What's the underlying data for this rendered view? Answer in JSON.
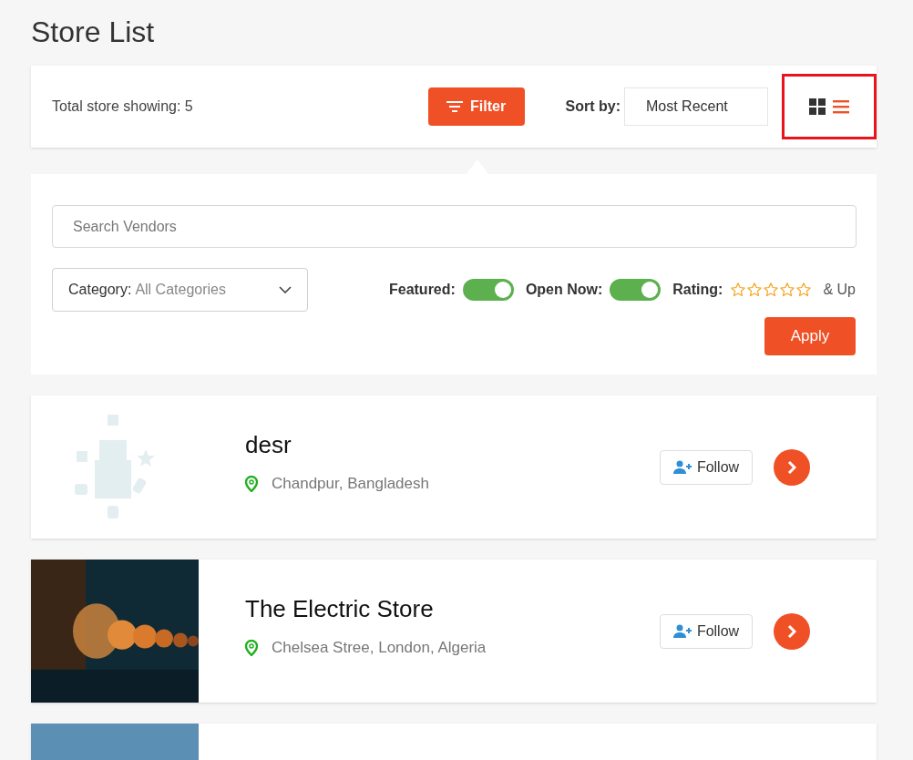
{
  "page_title": "Store List",
  "toolbar": {
    "count_text": "Total store showing: 5",
    "filter_button": "Filter",
    "sort_label": "Sort by:",
    "sort_value": "Most Recent",
    "highlighted": true,
    "views": [
      {
        "kind": "grid",
        "selected": false
      },
      {
        "kind": "list",
        "selected": true
      }
    ]
  },
  "filters": {
    "search": {
      "placeholder": "Search Vendors"
    },
    "category": {
      "label": "Category:",
      "value": "All Categories"
    },
    "toggles": [
      {
        "label": "Featured:",
        "on": true
      },
      {
        "label": "Open Now:",
        "on": true
      }
    ],
    "rating": {
      "label": "Rating:",
      "stars": 0,
      "suffix": "& Up"
    },
    "apply_button": "Apply"
  },
  "stores": [
    {
      "kind": "placeholder",
      "name": "desr",
      "location": "Chandpur, Bangladesh",
      "follow": "Follow"
    },
    {
      "kind": "picture",
      "name": "The Electric Store",
      "location": "Chelsea Stree, London, Algeria",
      "follow": "Follow"
    },
    {
      "kind": "picture"
    }
  ]
}
